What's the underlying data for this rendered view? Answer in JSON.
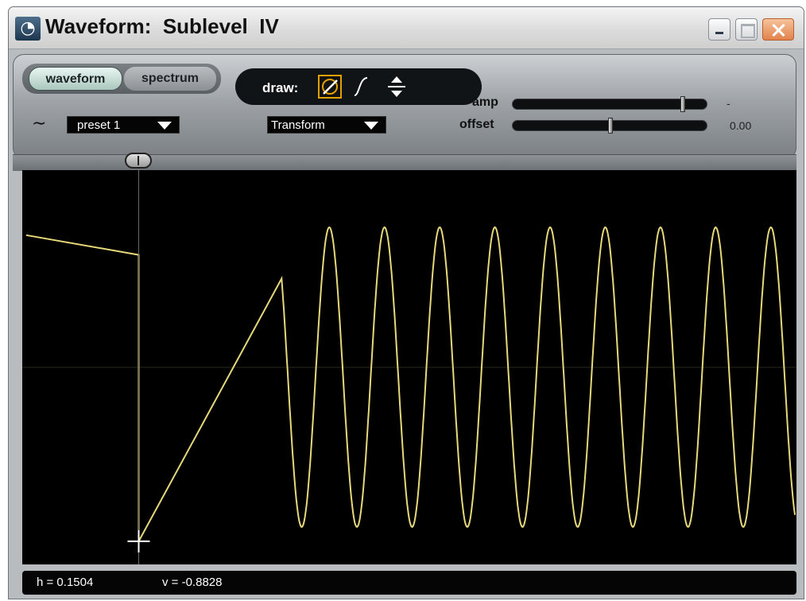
{
  "window": {
    "title": "Waveform:  Sublevel  IV",
    "app_icon": "swirl-icon",
    "controls": [
      "minimize-icon",
      "maximize-icon",
      "close-icon"
    ]
  },
  "tabs": [
    {
      "label": "waveform",
      "active": true
    },
    {
      "label": "spectrum",
      "active": false
    }
  ],
  "wave_icon": "tilde-wave-icon",
  "preset_dropdown": {
    "value": "preset 1"
  },
  "draw": {
    "label": "draw:",
    "tools": [
      {
        "name": "line-draw-icon",
        "selected": true
      },
      {
        "name": "curve-draw-icon",
        "selected": false
      },
      {
        "name": "scale-vertical-icon",
        "selected": false
      }
    ]
  },
  "transform_dropdown": {
    "value": "Transform"
  },
  "sliders": {
    "amp": {
      "label": "amp",
      "value_text": "-",
      "level": 0.87
    },
    "offset": {
      "label": "offset",
      "value_text": "0.00",
      "level": 0.5
    }
  },
  "ruler_handle_position": 0.1504,
  "waveform": {
    "trace_color": "#e6d97a",
    "background": "#000000",
    "cursor": {
      "h": 0.1504,
      "v": -0.8828
    }
  },
  "status": {
    "h_text": "h = 0.1504",
    "v_text": "v = -0.8828"
  }
}
